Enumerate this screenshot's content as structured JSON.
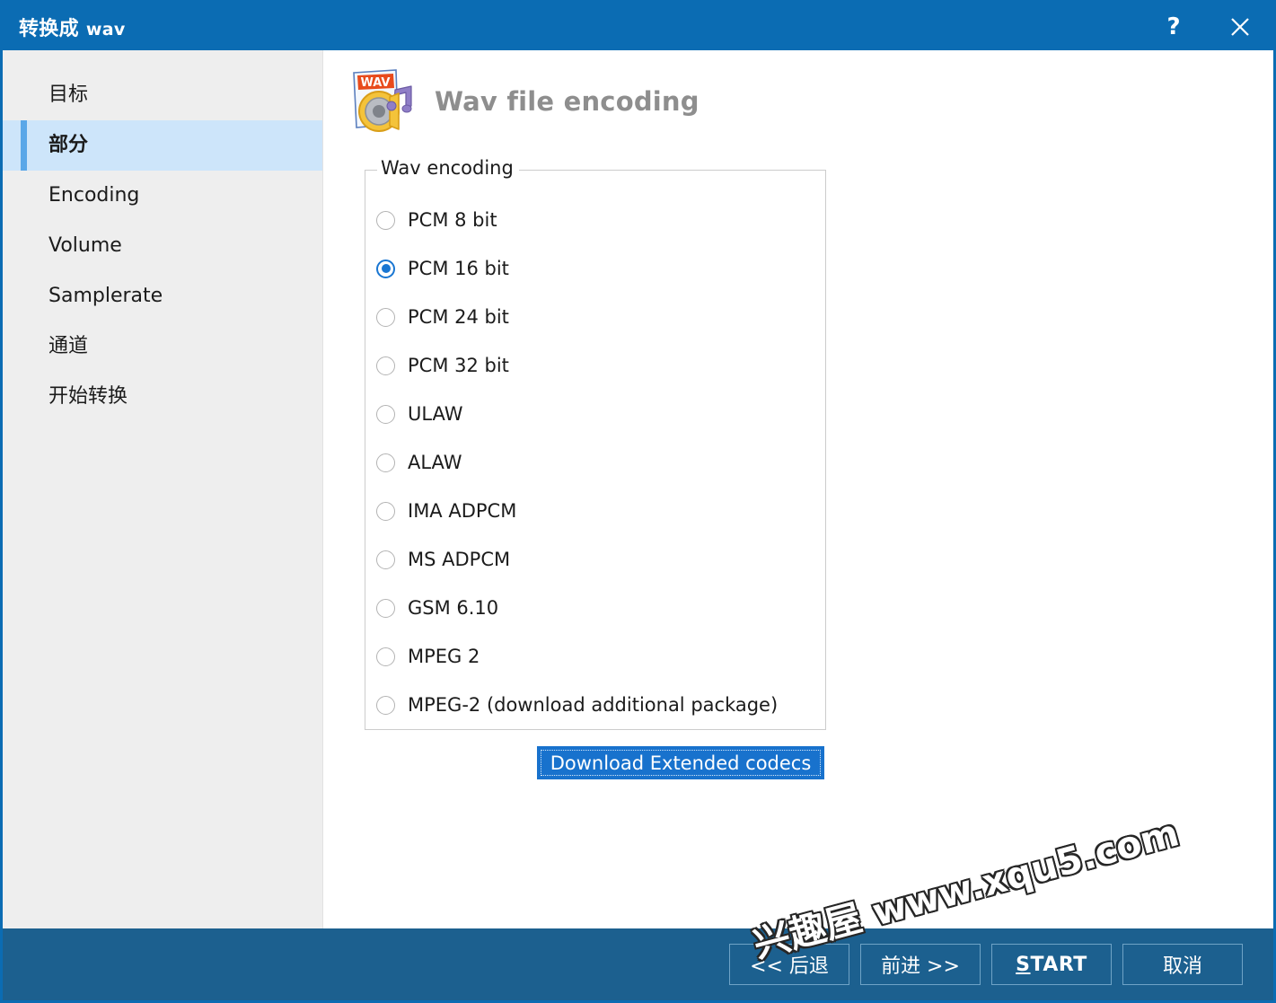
{
  "window": {
    "title_cjk": "转换成",
    "title_ext": "wav",
    "help_icon": "question-mark-icon",
    "close_icon": "close-icon",
    "accent_color": "#0b6cb3",
    "bottom_bar_color": "#1c608f"
  },
  "sidebar": {
    "items": [
      {
        "label": "目标",
        "active": false
      },
      {
        "label": "部分",
        "active": true
      },
      {
        "label": "Encoding",
        "active": false
      },
      {
        "label": "Volume",
        "active": false
      },
      {
        "label": "Samplerate",
        "active": false
      },
      {
        "label": "通道",
        "active": false
      },
      {
        "label": "开始转换",
        "active": false
      }
    ]
  },
  "main": {
    "icon_name": "wav-file-icon",
    "page_title": "Wav file encoding",
    "group_legend": "Wav encoding",
    "options": [
      {
        "label": "PCM 8 bit",
        "checked": false
      },
      {
        "label": "PCM 16 bit",
        "checked": true
      },
      {
        "label": "PCM 24 bit",
        "checked": false
      },
      {
        "label": "PCM 32 bit",
        "checked": false
      },
      {
        "label": "ULAW",
        "checked": false
      },
      {
        "label": "ALAW",
        "checked": false
      },
      {
        "label": "IMA ADPCM",
        "checked": false
      },
      {
        "label": "MS ADPCM",
        "checked": false
      },
      {
        "label": "GSM 6.10",
        "checked": false
      },
      {
        "label": "MPEG 2",
        "checked": false
      },
      {
        "label": "MPEG-2 (download additional package)",
        "checked": false
      }
    ],
    "download_button": "Download Extended codecs"
  },
  "footer": {
    "back": "<< 后退",
    "next": "前进 >>",
    "start_accel": "S",
    "start_rest": "TART",
    "cancel": "取消"
  },
  "watermark": {
    "text": "兴趣屋 www.xqu5.com"
  }
}
